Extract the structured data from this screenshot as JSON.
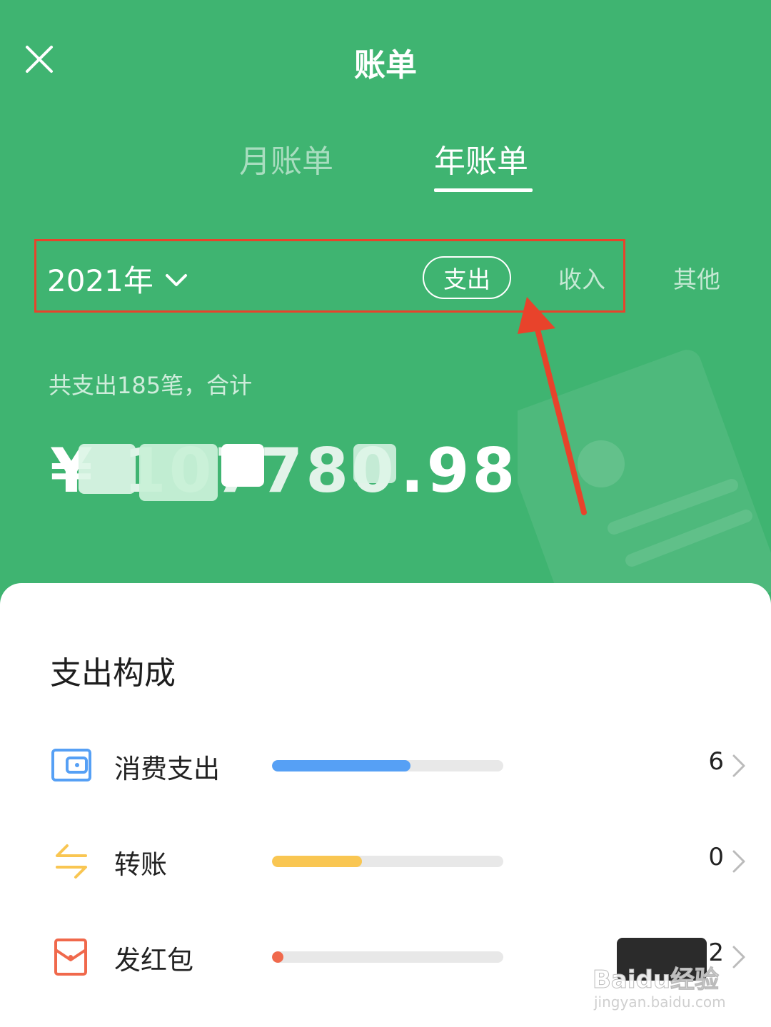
{
  "header": {
    "title": "账单",
    "tabs": [
      {
        "label": "月账单",
        "active": false
      },
      {
        "label": "年账单",
        "active": true
      }
    ]
  },
  "filters": {
    "year": "2021年",
    "type_active": "支出",
    "type_income": "收入",
    "type_other": "其他"
  },
  "summary": {
    "text": "共支出185笔，合计",
    "amount_visible": "¥",
    "amount_tail": ".98"
  },
  "breakdown": {
    "title": "支出构成",
    "items": [
      {
        "label": "消费支出",
        "color": "#56a0f5",
        "amount_tail": "6",
        "share": 0.6
      },
      {
        "label": "转账",
        "color": "#f9c652",
        "amount_tail": "0",
        "share": 0.39
      },
      {
        "label": "发红包",
        "color": "#f0694c",
        "amount_tail": "2",
        "share": 0.05
      }
    ]
  },
  "colors": {
    "brand_green": "#3fb471",
    "highlight": "#e8432b"
  },
  "watermark": {
    "main": "Baidu经验",
    "sub": "jingyan.baidu.com"
  }
}
